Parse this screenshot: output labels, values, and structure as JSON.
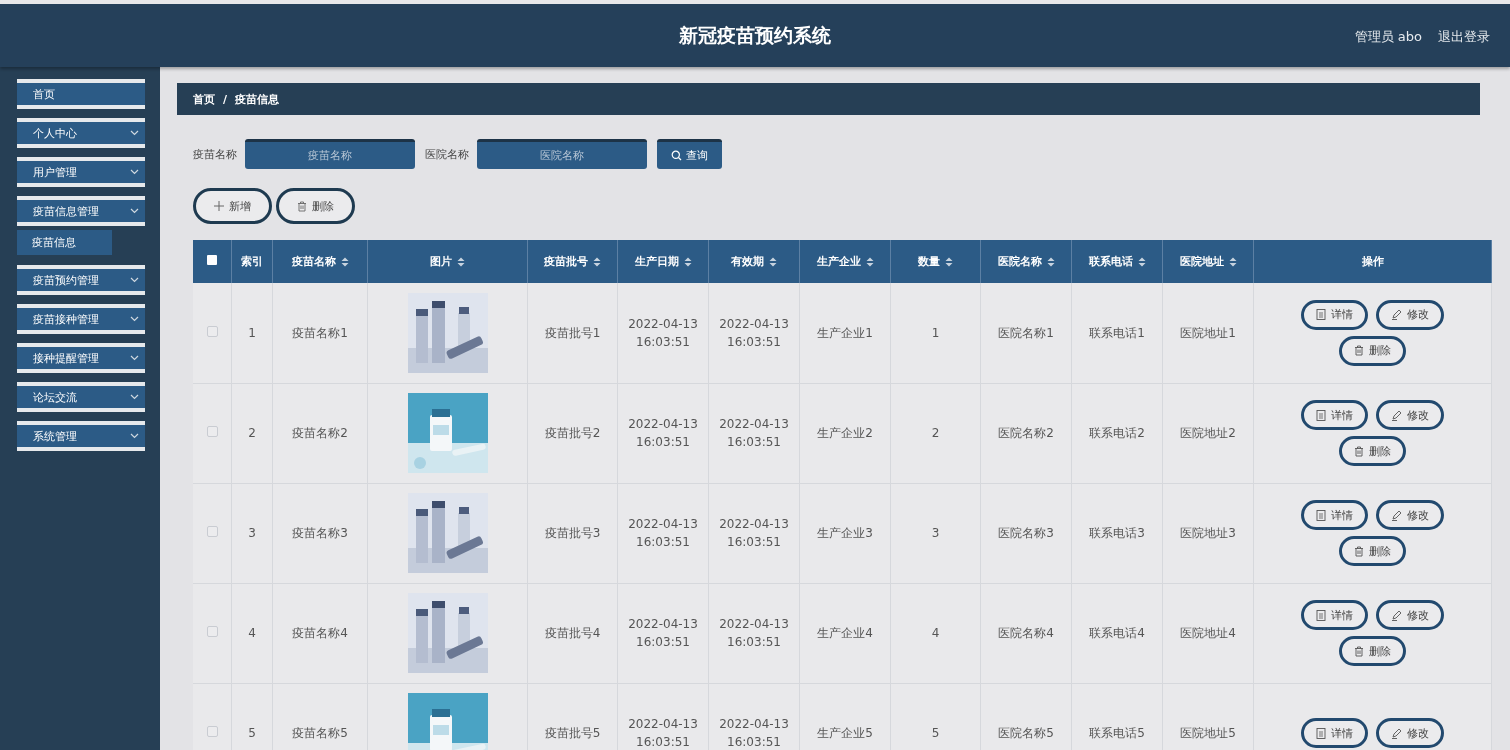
{
  "header": {
    "title": "新冠疫苗预约系统",
    "user": "管理员 abo",
    "logout": "退出登录"
  },
  "sidebar": {
    "items": [
      {
        "label": "首页",
        "kind": "link"
      },
      {
        "label": "个人中心",
        "kind": "menu"
      },
      {
        "label": "用户管理",
        "kind": "menu"
      },
      {
        "label": "疫苗信息管理",
        "kind": "menu",
        "children": [
          {
            "label": "疫苗信息",
            "selected": true
          }
        ]
      },
      {
        "label": "疫苗预约管理",
        "kind": "menu"
      },
      {
        "label": "疫苗接种管理",
        "kind": "menu"
      },
      {
        "label": "接种提醒管理",
        "kind": "menu"
      },
      {
        "label": "论坛交流",
        "kind": "menu"
      },
      {
        "label": "系统管理",
        "kind": "menu"
      }
    ]
  },
  "breadcrumb": {
    "items": [
      "首页",
      "疫苗信息"
    ],
    "separator": "/"
  },
  "search": {
    "fields": [
      {
        "label": "疫苗名称",
        "placeholder": "疫苗名称"
      },
      {
        "label": "医院名称",
        "placeholder": "医院名称"
      }
    ],
    "button": "查询"
  },
  "toolbar": [
    {
      "label": "新增",
      "kind": "add"
    },
    {
      "label": "删除",
      "kind": "delete"
    }
  ],
  "table": {
    "select_all": {
      "checked": false
    },
    "columns": [
      {
        "label": "索引",
        "sortable": false
      },
      {
        "label": "疫苗名称",
        "sortable": true
      },
      {
        "label": "图片",
        "sortable": true
      },
      {
        "label": "疫苗批号",
        "sortable": true
      },
      {
        "label": "生产日期",
        "sortable": true
      },
      {
        "label": "有效期",
        "sortable": true
      },
      {
        "label": "生产企业",
        "sortable": true
      },
      {
        "label": "数量",
        "sortable": true
      },
      {
        "label": "医院名称",
        "sortable": true
      },
      {
        "label": "联系电话",
        "sortable": true
      },
      {
        "label": "医院地址",
        "sortable": true
      },
      {
        "label": "操作",
        "sortable": false
      }
    ],
    "rows": [
      {
        "checked": false,
        "cells": [
          "1",
          "疫苗名称1",
          null,
          "疫苗批号1",
          "2022-04-13 16:03:51",
          "2022-04-13 16:03:51",
          "生产企业1",
          "1",
          "医院名称1",
          "联系电话1",
          "医院地址1"
        ],
        "actions": [
          {
            "label": "详情",
            "kind": "detail"
          },
          {
            "label": "修改",
            "kind": "edit"
          },
          {
            "label": "删除",
            "kind": "delete"
          }
        ]
      },
      {
        "checked": false,
        "cells": [
          "2",
          "疫苗名称2",
          null,
          "疫苗批号2",
          "2022-04-13 16:03:51",
          "2022-04-13 16:03:51",
          "生产企业2",
          "2",
          "医院名称2",
          "联系电话2",
          "医院地址2"
        ],
        "actions": [
          {
            "label": "详情",
            "kind": "detail"
          },
          {
            "label": "修改",
            "kind": "edit"
          },
          {
            "label": "删除",
            "kind": "delete"
          }
        ]
      },
      {
        "checked": false,
        "cells": [
          "3",
          "疫苗名称3",
          null,
          "疫苗批号3",
          "2022-04-13 16:03:51",
          "2022-04-13 16:03:51",
          "生产企业3",
          "3",
          "医院名称3",
          "联系电话3",
          "医院地址3"
        ],
        "actions": [
          {
            "label": "详情",
            "kind": "detail"
          },
          {
            "label": "修改",
            "kind": "edit"
          },
          {
            "label": "删除",
            "kind": "delete"
          }
        ]
      },
      {
        "checked": false,
        "cells": [
          "4",
          "疫苗名称4",
          null,
          "疫苗批号4",
          "2022-04-13 16:03:51",
          "2022-04-13 16:03:51",
          "生产企业4",
          "4",
          "医院名称4",
          "联系电话4",
          "医院地址4"
        ],
        "actions": [
          {
            "label": "详情",
            "kind": "detail"
          },
          {
            "label": "修改",
            "kind": "edit"
          },
          {
            "label": "删除",
            "kind": "delete"
          }
        ]
      },
      {
        "checked": false,
        "cells": [
          "5",
          "疫苗名称5",
          null,
          "疫苗批号5",
          "2022-04-13 16:03:51",
          "2022-04-13 16:03:51",
          "生产企业5",
          "5",
          "医院名称5",
          "联系电话5",
          "医院地址5"
        ],
        "actions": [
          {
            "label": "详情",
            "kind": "detail"
          },
          {
            "label": "修改",
            "kind": "edit"
          }
        ]
      }
    ]
  }
}
